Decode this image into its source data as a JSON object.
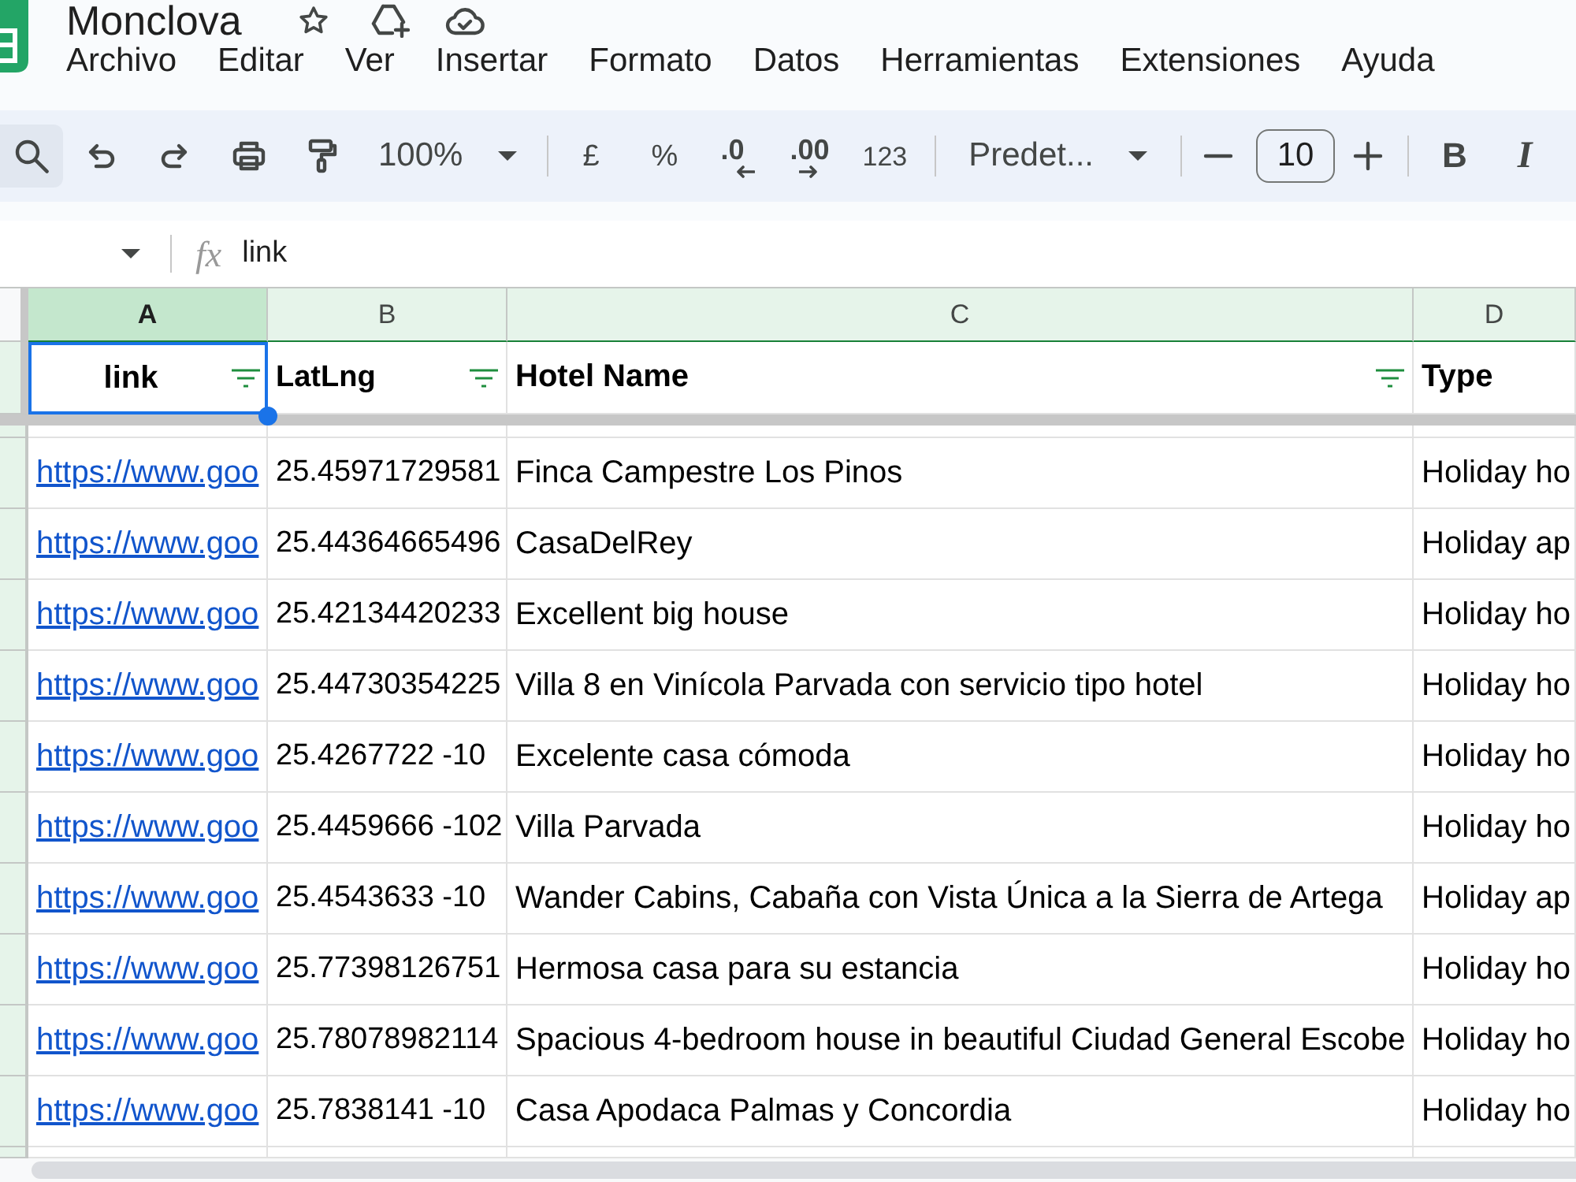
{
  "document": {
    "title": "Monclova"
  },
  "menu": [
    "Archivo",
    "Editar",
    "Ver",
    "Insertar",
    "Formato",
    "Datos",
    "Herramientas",
    "Extensiones",
    "Ayuda"
  ],
  "toolbar": {
    "zoom": "100%",
    "currency": "£",
    "percent": "%",
    "decrease_decimals": ".0",
    "increase_decimals": ".00",
    "number_format": "123",
    "font": "Predet...",
    "font_size": "10",
    "bold": "B",
    "italic": "I"
  },
  "formula_bar": {
    "function_label": "fx",
    "value": "link"
  },
  "sheet": {
    "columns": [
      {
        "header": "A",
        "title": "link",
        "selected": true,
        "filter": true,
        "kind": "link"
      },
      {
        "header": "B",
        "title": "LatLng",
        "selected": false,
        "filter": true,
        "kind": "text"
      },
      {
        "header": "C",
        "title": "Hotel Name",
        "selected": false,
        "filter": true,
        "kind": "text"
      },
      {
        "header": "D",
        "title": "Type",
        "selected": false,
        "filter": false,
        "kind": "text"
      }
    ],
    "rows": [
      [
        "https://www.goo",
        "25.45971729581",
        "Finca Campestre Los Pinos",
        "Holiday ho"
      ],
      [
        "https://www.goo",
        "25.44364665496",
        "CasaDelRey",
        "Holiday ap"
      ],
      [
        "https://www.goo",
        "25.42134420233",
        "Excellent big house",
        "Holiday ho"
      ],
      [
        "https://www.goo",
        "25.44730354225",
        "Villa 8 en Vinícola Parvada con servicio tipo hotel",
        "Holiday ho"
      ],
      [
        "https://www.goo",
        "25.4267722 -10",
        "Excelente casa cómoda",
        "Holiday ho"
      ],
      [
        "https://www.goo",
        "25.4459666 -102",
        "Villa Parvada",
        "Holiday ho"
      ],
      [
        "https://www.goo",
        "25.4543633 -10",
        "Wander Cabins, Cabaña con Vista Única a la Sierra de Artega",
        "Holiday ap"
      ],
      [
        "https://www.goo",
        "25.77398126751",
        "Hermosa casa para su estancia",
        "Holiday ho"
      ],
      [
        "https://www.goo",
        "25.78078982114",
        "Spacious 4-bedroom house in beautiful Ciudad General Escobe",
        "Holiday ho"
      ],
      [
        "https://www.goo",
        "25.7838141 -10",
        "Casa Apodaca Palmas y Concordia",
        "Holiday ho"
      ]
    ]
  }
}
